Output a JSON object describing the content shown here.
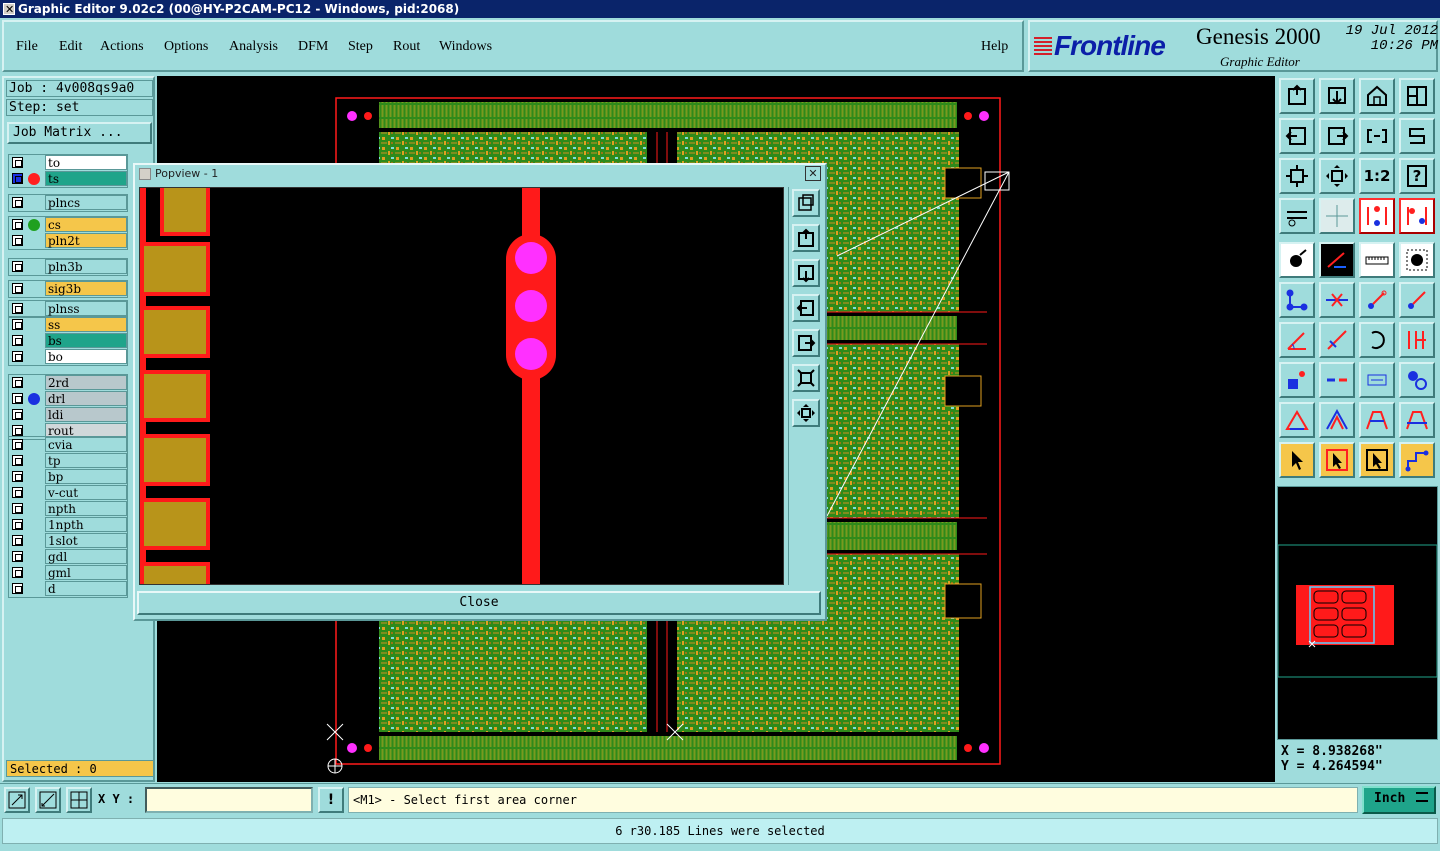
{
  "window": {
    "title": "Graphic Editor 9.02c2 (00@HY-P2CAM-PC12 - Windows, pid:2068)"
  },
  "menu": {
    "items": [
      {
        "label": "File"
      },
      {
        "label": "Edit"
      },
      {
        "label": "Actions"
      },
      {
        "label": "Options"
      },
      {
        "label": "Analysis"
      },
      {
        "label": "DFM"
      },
      {
        "label": "Step"
      },
      {
        "label": "Rout"
      },
      {
        "label": "Windows"
      }
    ],
    "help": "Help"
  },
  "brand": {
    "logo": "Frontline",
    "product": "Genesis 2000",
    "subtitle": "Graphic Editor",
    "date": "19 Jul 2012",
    "time": "10:26 PM"
  },
  "job": {
    "job_line": "Job : 4v008qs9a0",
    "step_line": "Step: set",
    "matrix_button": "Job Matrix ..."
  },
  "layers": [
    {
      "name": "to",
      "bg": "#ffffff",
      "dot": ""
    },
    {
      "name": "ts",
      "bg": "#1fa48a",
      "dot": "#ff2020",
      "active": true
    },
    {
      "name": "plncs",
      "bg": "#9fdcdc",
      "dot": ""
    },
    {
      "name": "cs",
      "bg": "#f5c64a",
      "dot": "#20a020"
    },
    {
      "name": "pln2t",
      "bg": "#f5c64a",
      "dot": ""
    },
    {
      "name": "pln3b",
      "bg": "#9fdcdc",
      "dot": ""
    },
    {
      "name": "sig3b",
      "bg": "#f5c64a",
      "dot": ""
    },
    {
      "name": "plnss",
      "bg": "#9fdcdc",
      "dot": ""
    },
    {
      "name": "ss",
      "bg": "#f5c64a",
      "dot": ""
    },
    {
      "name": "bs",
      "bg": "#1fa48a",
      "dot": ""
    },
    {
      "name": "bo",
      "bg": "#ffffff",
      "dot": ""
    },
    {
      "name": "2rd",
      "bg": "#b8c8cc",
      "dot": ""
    },
    {
      "name": "drl",
      "bg": "#b8c8cc",
      "dot": "#1a30e0"
    },
    {
      "name": "ldi",
      "bg": "#b8c8cc",
      "dot": ""
    },
    {
      "name": "rout",
      "bg": "#d0d8da",
      "dot": ""
    },
    {
      "name": "cvia",
      "bg": "#9fdcdc",
      "dot": ""
    },
    {
      "name": "tp",
      "bg": "#9fdcdc",
      "dot": ""
    },
    {
      "name": "bp",
      "bg": "#9fdcdc",
      "dot": ""
    },
    {
      "name": "v-cut",
      "bg": "#9fdcdc",
      "dot": ""
    },
    {
      "name": "npth",
      "bg": "#9fdcdc",
      "dot": ""
    },
    {
      "name": "1npth",
      "bg": "#9fdcdc",
      "dot": ""
    },
    {
      "name": "1slot",
      "bg": "#9fdcdc",
      "dot": ""
    },
    {
      "name": "gdl",
      "bg": "#9fdcdc",
      "dot": ""
    },
    {
      "name": "gml",
      "bg": "#9fdcdc",
      "dot": ""
    },
    {
      "name": "d",
      "bg": "#9fdcdc",
      "dot": ""
    }
  ],
  "selected": "Selected : 0",
  "popview": {
    "title": "Popview - 1",
    "close_x": "✕",
    "close_button": "Close"
  },
  "coords": {
    "x": "X = 8.938268\"",
    "y": "Y = 4.264594\""
  },
  "command": {
    "xy_label": "X Y :",
    "xy_value": "",
    "prompt": "<M1> - Select first area corner",
    "unit": "Inch",
    "exclaim": "!"
  },
  "status": "6 r30.185 Lines were selected",
  "toolbar_glyphs": {
    "ratio": "1:2",
    "query": "?"
  },
  "colors": {
    "board_green": "#2f8a1a",
    "copper_orange": "#e0a020",
    "outline_red": "#ff1a1a",
    "pad_gold": "#b8941a",
    "pad_magenta": "#ff30ff"
  }
}
